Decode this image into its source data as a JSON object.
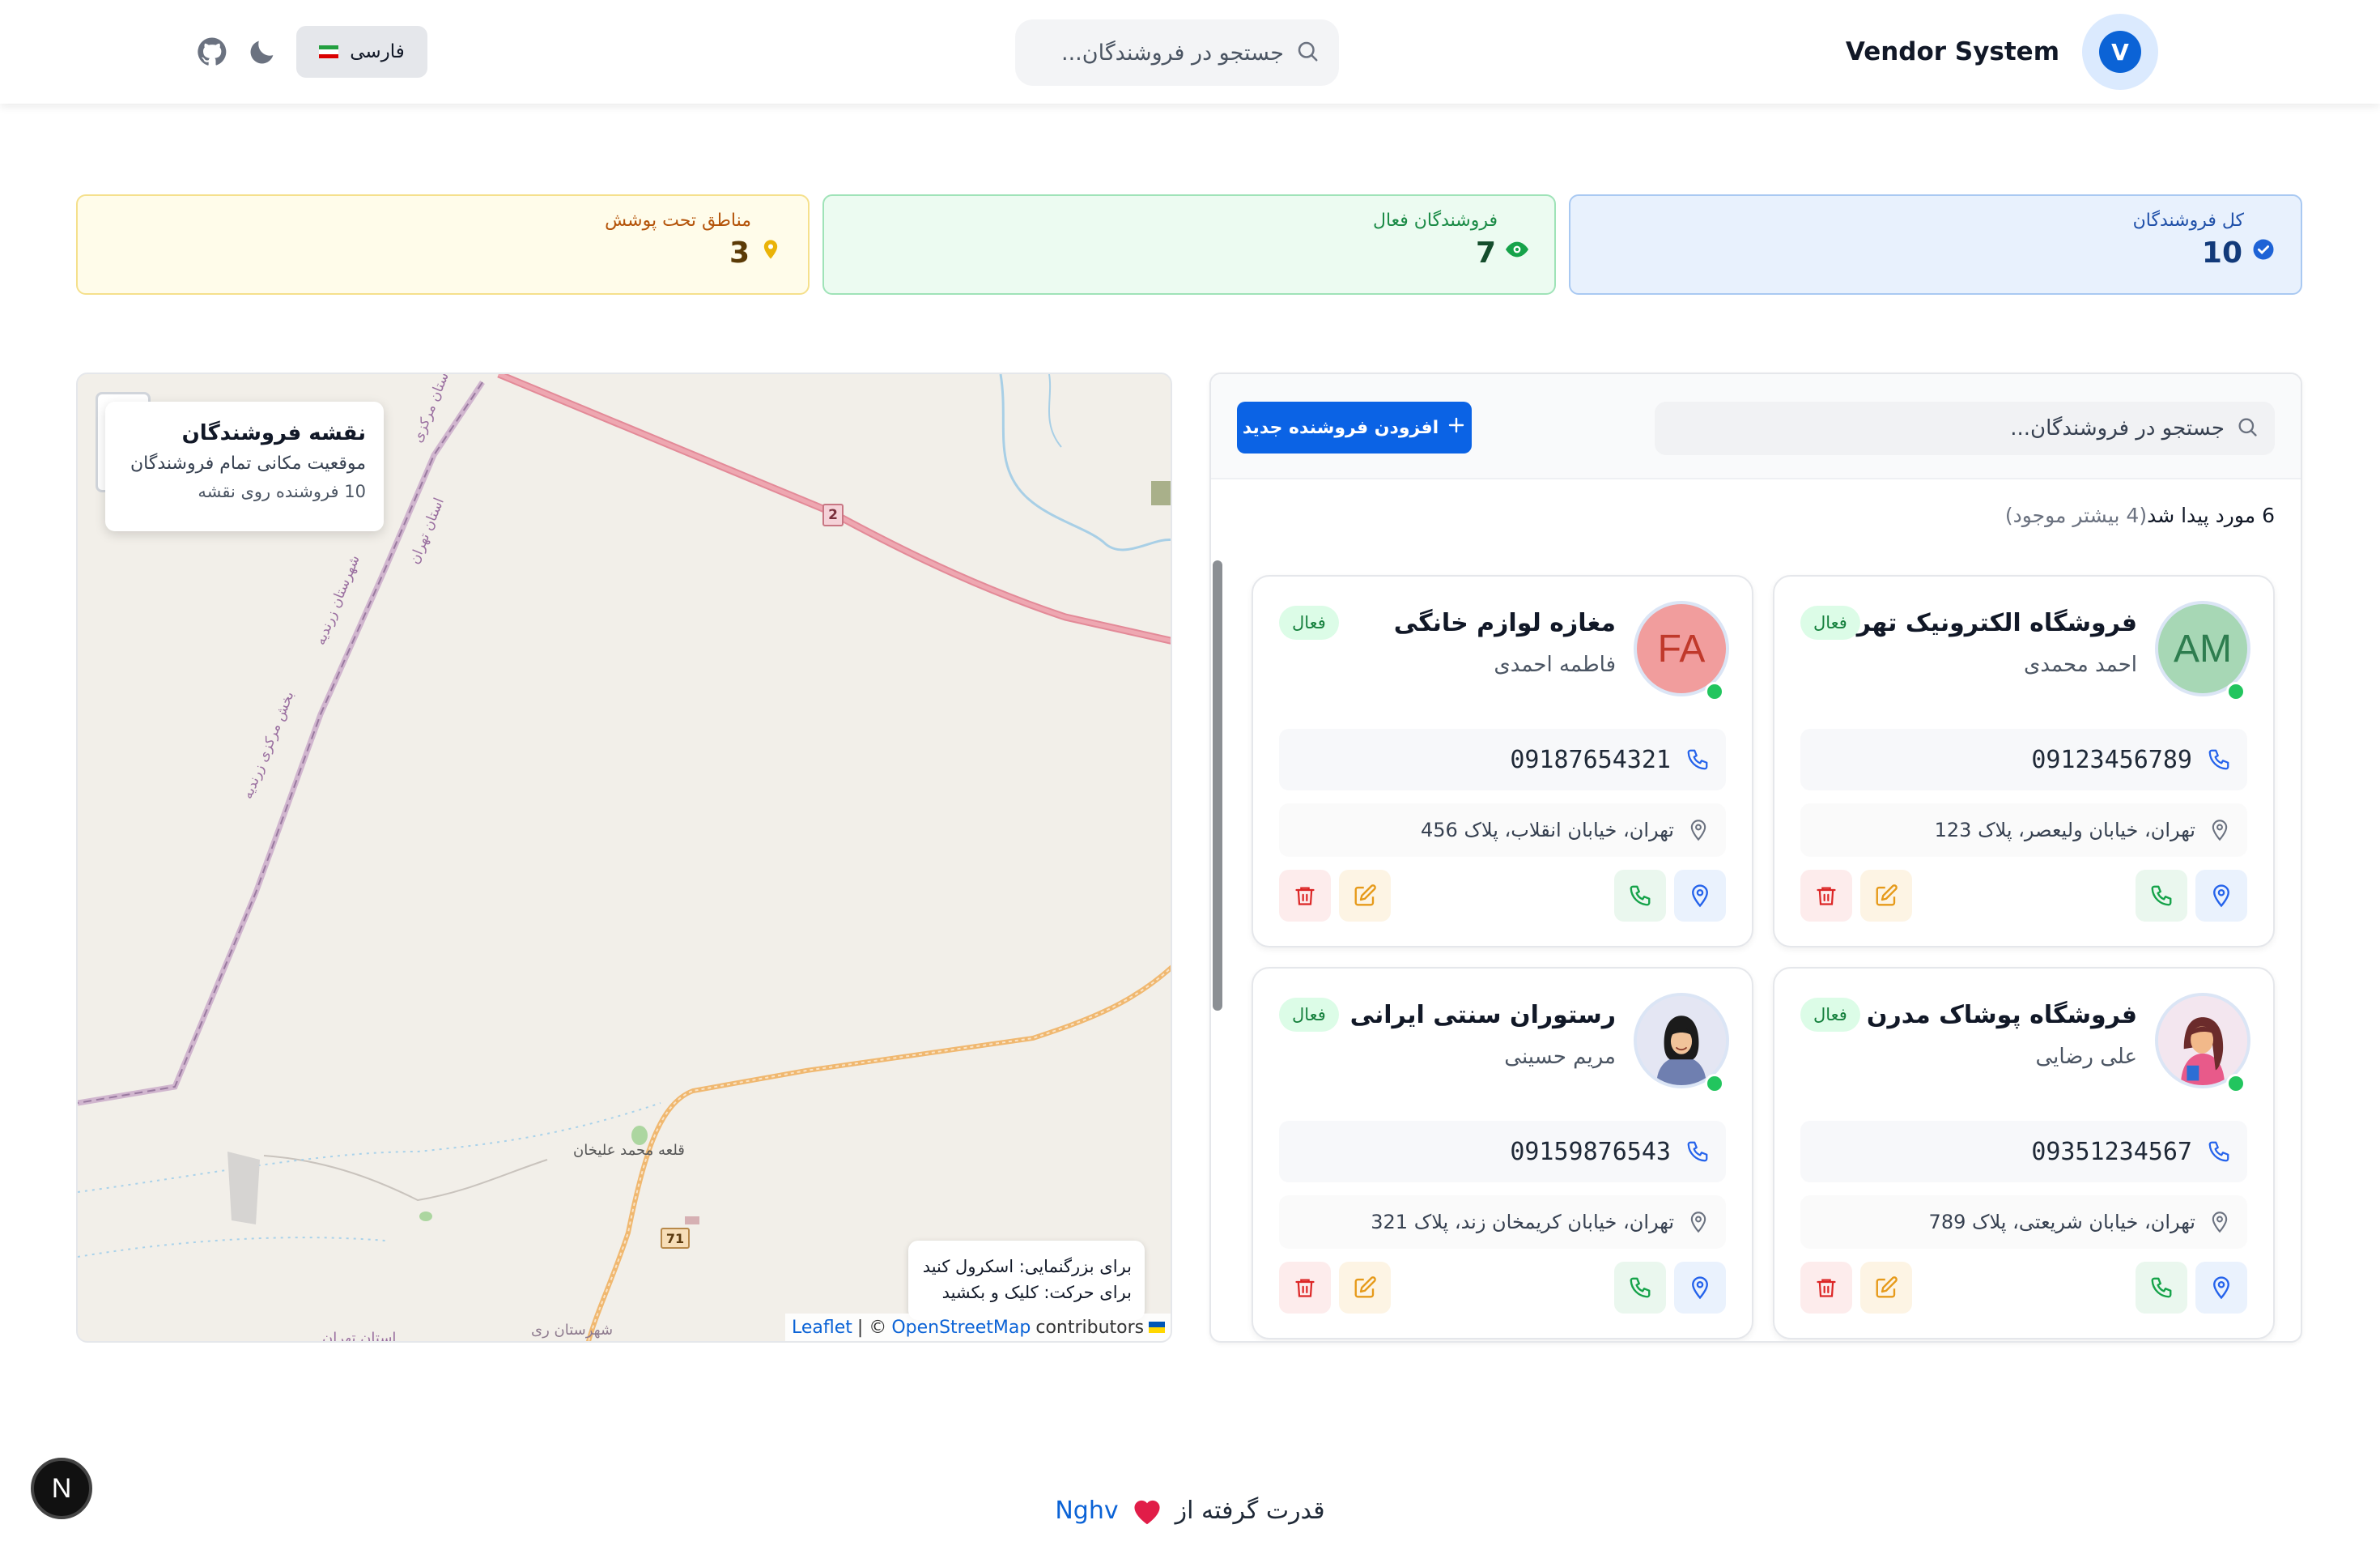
{
  "header": {
    "brand_name": "Vendor System",
    "brand_logo_letter": "V",
    "search_placeholder": "جستجو در فروشندگان...",
    "language_label": "فارسی",
    "icons": [
      "search-icon",
      "moon-icon",
      "github-icon"
    ]
  },
  "stats": {
    "total": {
      "label": "کل فروشندگان",
      "value": "10",
      "color": "#1e4fa8"
    },
    "active": {
      "label": "فروشندگان فعال",
      "value": "7",
      "color": "#198a45"
    },
    "regions": {
      "label": "مناطق تحت پوشش",
      "value": "3",
      "color": "#b45309"
    }
  },
  "vendors_panel": {
    "search_placeholder": "جستجو در فروشندگان...",
    "add_button_label": "افزودن فروشنده جدید",
    "result_found": "6 مورد پیدا شد",
    "result_more": "(4 بیشتر موجود)",
    "status_color": "#22c55e"
  },
  "vendors": [
    {
      "name": "فروشگاه الکترونیک تهران",
      "owner": "احمد محمدی",
      "status": "فعال",
      "phone": "09123456789",
      "address": "تهران، خیابان ولیعصر، پلاک 123",
      "initials": "AM",
      "avatar_bg": "#a7d7b5",
      "avatar_fg": "#2e7d4f"
    },
    {
      "name": "مغازه لوازم خانگی",
      "owner": "فاطمه احمدی",
      "status": "فعال",
      "phone": "09187654321",
      "address": "تهران، خیابان انقلاب، پلاک 456",
      "initials": "FA",
      "avatar_bg": "#f19d9d",
      "avatar_fg": "#c0392b"
    },
    {
      "name": "فروشگاه پوشاک مدرن",
      "owner": "علی رضایی",
      "status": "فعال",
      "phone": "09351234567",
      "address": "تهران، خیابان شریعتی، پلاک 789",
      "initials": "",
      "avatar_bg": "#f3e6ef",
      "avatar_fg": "#000000"
    },
    {
      "name": "رستوران سنتی ایرانی",
      "owner": "مریم حسینی",
      "status": "فعال",
      "phone": "09159876543",
      "address": "تهران، خیابان کریمخان زند، پلاک 321",
      "initials": "",
      "avatar_bg": "#e4e6f3",
      "avatar_fg": "#000000"
    }
  ],
  "map": {
    "info_title": "نقشه فروشندگان",
    "info_subtitle": "موقعیت مکانی تمام فروشندگان",
    "info_count": "10 فروشنده روی نقشه",
    "hint_zoom": "برای بزرگنمایی: اسکرول کنید",
    "hint_pan": "برای حرکت: کلیک و بکشید",
    "attribution_leaflet": "Leaflet",
    "attribution_sep": "| ©",
    "attribution_osm": "OpenStreetMap",
    "attribution_contrib": "contributors",
    "labels": {
      "road_2": "2",
      "road_71": "71",
      "village": "قلعه محمد علیخان",
      "province_markazi_1": "استان مرکزی",
      "province_tehran_1": "استان تهران",
      "county_zarandieh": "شهرستان زرندیه",
      "district_zarandieh": "بخش مرکزی زرندیه",
      "county_rey": "شهرستان ری",
      "province_tehran_2": "استان تهران"
    }
  },
  "footer": {
    "powered_by": "قدرت گرفته از",
    "author": "Nghv",
    "heart_color": "#e11d48"
  },
  "nextjs_badge": "N"
}
